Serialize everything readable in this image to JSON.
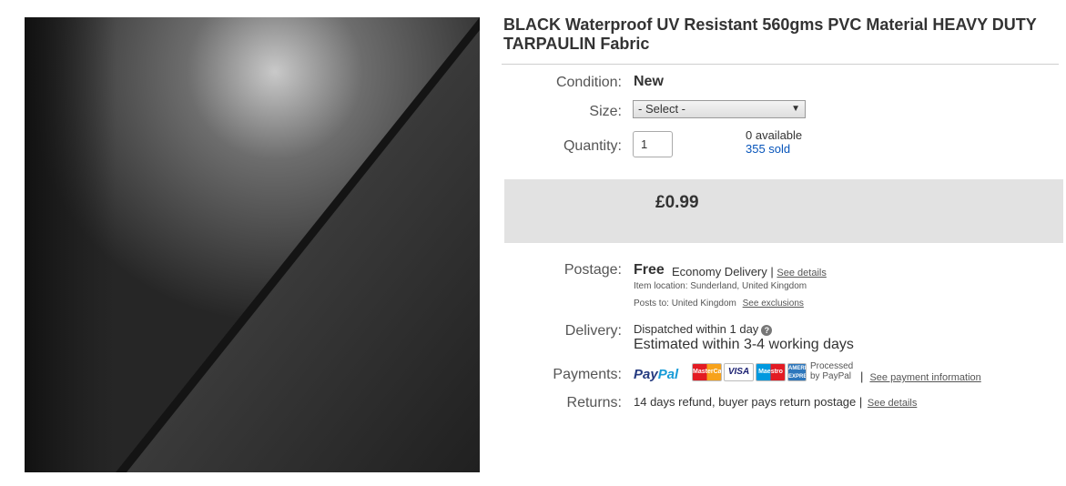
{
  "listing": {
    "title": "BLACK Waterproof UV Resistant 560gms PVC Material HEAVY DUTY TARPAULIN Fabric",
    "condition_label": "Condition:",
    "condition_value": "New",
    "size_label": "Size:",
    "size_selected": "- Select -",
    "quantity_label": "Quantity:",
    "quantity_value": "1",
    "available_text": "0 available",
    "sold_text": "355 sold",
    "price": "£0.99"
  },
  "postage": {
    "label": "Postage:",
    "cost": "Free",
    "service": "Economy Delivery",
    "separator": "|",
    "details_link": "See details",
    "item_location_label": "Item location:",
    "item_location": "Sunderland, United Kingdom",
    "posts_to_label": "Posts to:",
    "posts_to": "United Kingdom",
    "exclusions_link": "See exclusions"
  },
  "delivery": {
    "label": "Delivery:",
    "dispatch": "Dispatched within 1 day",
    "help_glyph": "?",
    "estimate": "Estimated within 3-4 working days"
  },
  "payments": {
    "label": "Payments:",
    "paypal_part1": "Pay",
    "paypal_part2": "Pal",
    "cards": {
      "mastercard": "MasterCard",
      "visa": "VISA",
      "maestro": "Maestro",
      "amex": "AMERICAN EXPRESS"
    },
    "processed_line1": "Processed",
    "processed_line2": "by PayPal",
    "separator": "|",
    "info_link": "See payment information"
  },
  "returns": {
    "label": "Returns:",
    "policy": "14 days refund, buyer pays return postage",
    "separator": "|",
    "details_link": "See details"
  },
  "colors": {
    "link": "#0654ba",
    "price_box": "#e2e2e2",
    "paypal_dark": "#253b80",
    "paypal_light": "#179bd7"
  }
}
